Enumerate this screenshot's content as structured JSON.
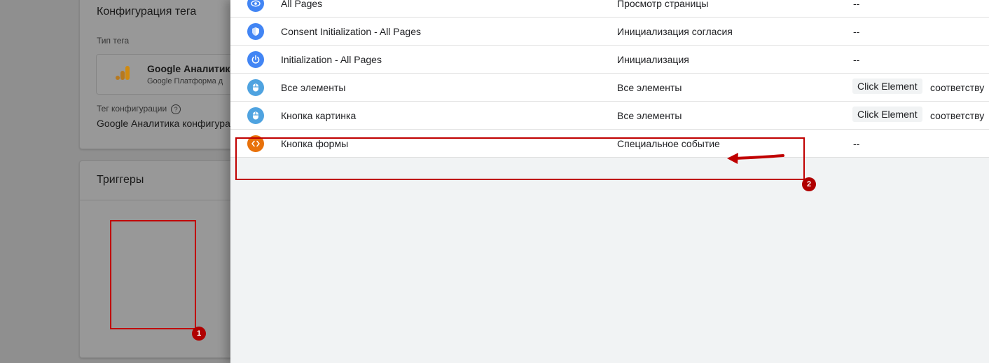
{
  "tag_editor": {
    "config_title": "Конфигурация тега",
    "tag_type_label": "Тип тега",
    "tag_type_name": "Google Аналитика",
    "tag_type_sub": "Google Платформа д",
    "config_tag_label": "Тег конфигурации",
    "config_tag_help": "?",
    "config_tag_value": "Google Аналитика конфигура",
    "triggers_title": "Триггеры"
  },
  "trigger_list": {
    "rows": [
      {
        "name": "All Pages",
        "type": "Просмотр страницы",
        "filter": "--",
        "icon": "eye-icon",
        "icon_color": "#4285f4"
      },
      {
        "name": "Consent Initialization - All Pages",
        "type": "Инициализация согласия",
        "filter": "--",
        "icon": "shield-icon",
        "icon_color": "#4285f4"
      },
      {
        "name": "Initialization - All Pages",
        "type": "Инициализация",
        "filter": "--",
        "icon": "power-icon",
        "icon_color": "#4285f4"
      },
      {
        "name": "Все элементы",
        "type": "Все элементы",
        "filter_chip": "Click Element",
        "filter_match": "соответству",
        "icon": "mouse-icon",
        "icon_color": "#4fa3e0"
      },
      {
        "name": "Кнопка картинка",
        "type": "Все элементы",
        "filter_chip": "Click Element",
        "filter_match": "соответству",
        "icon": "mouse-icon",
        "icon_color": "#4fa3e0"
      },
      {
        "name": "Кнопка формы",
        "type": "Специальное событие",
        "filter": "--",
        "icon": "code-icon",
        "icon_color": "#e8710a"
      }
    ]
  },
  "annotations": {
    "badge_1": "1",
    "badge_2": "2",
    "color": "#c00000"
  }
}
